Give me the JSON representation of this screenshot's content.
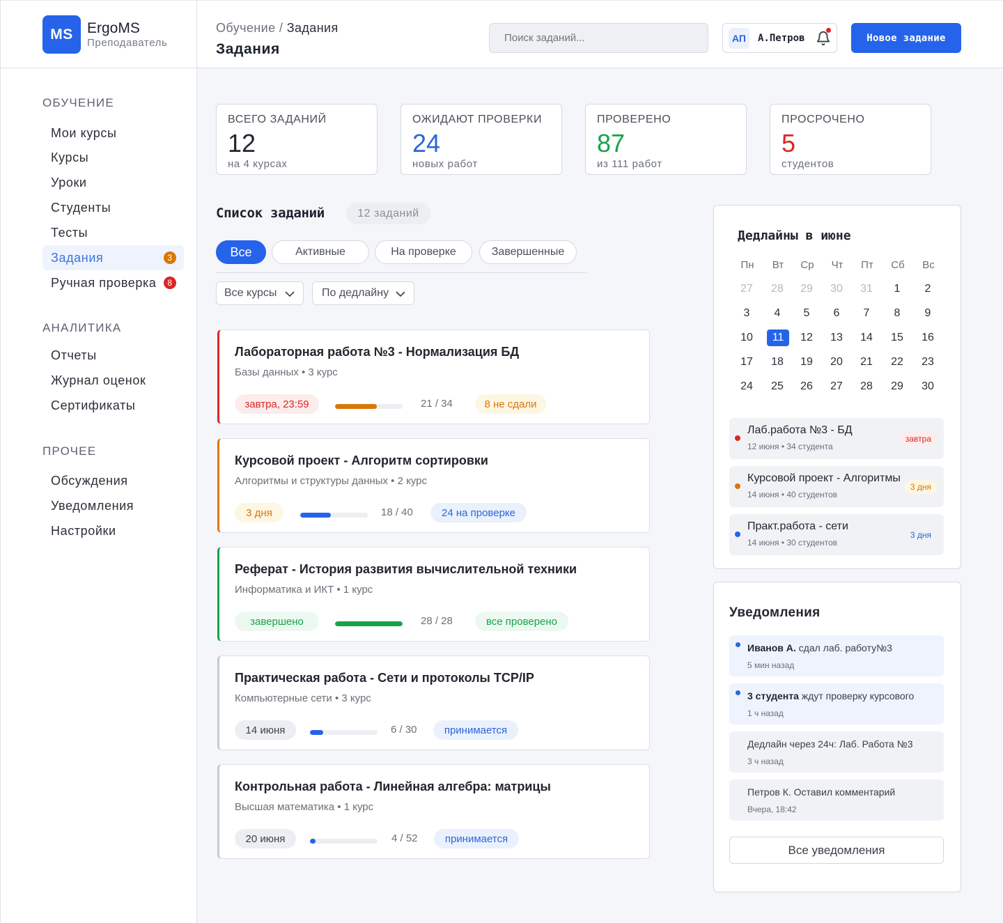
{
  "brand": {
    "logo_text": "MS",
    "name": "ErgoMS",
    "role": "Преподаватель"
  },
  "sidebar": {
    "sections": [
      {
        "title": "ОБУЧЕНИЕ",
        "items": [
          {
            "label": "Мои курсы"
          },
          {
            "label": "Курсы"
          },
          {
            "label": "Уроки"
          },
          {
            "label": "Студенты"
          },
          {
            "label": "Тесты"
          },
          {
            "label": "Задания",
            "badge": "3",
            "active": true
          },
          {
            "label": "Ручная проверка",
            "badge": "8"
          }
        ]
      },
      {
        "title": "АНАЛИТИКА",
        "items": [
          {
            "label": "Отчеты"
          },
          {
            "label": "Журнал оценок"
          },
          {
            "label": "Сертификаты"
          }
        ]
      },
      {
        "title": "ПРОЧЕЕ",
        "items": [
          {
            "label": "Обсуждения"
          },
          {
            "label": "Уведомления"
          },
          {
            "label": "Настройки"
          }
        ]
      }
    ]
  },
  "header": {
    "breadcrumb_parent": "Обучение",
    "breadcrumb_sep": " / ",
    "breadcrumb_current": "Задания",
    "title": "Задания",
    "search_placeholder": "Поиск заданий...",
    "user_initials": "АП",
    "user_name": "А.Петров",
    "new_button": "Новое задание"
  },
  "stats": [
    {
      "label": "ВСЕГО ЗАДАНИЙ",
      "value": "12",
      "sub": "на 4 курсах",
      "color": "#23262f"
    },
    {
      "label": "ОЖИДАЮТ ПРОВЕРКИ",
      "value": "24",
      "sub": "новых работ",
      "color": "#2d65d8"
    },
    {
      "label": "ПРОВЕРЕНО",
      "value": "87",
      "sub": "из 111 работ",
      "color": "#16a34a"
    },
    {
      "label": "ПРОСРОЧЕНО",
      "value": "5",
      "sub": "студентов",
      "color": "#dc2626"
    }
  ],
  "list": {
    "title": "Список заданий",
    "count": "12 заданий",
    "tabs": [
      "Все",
      "Активные",
      "На проверке",
      "Завершенные"
    ],
    "active_tab": 0,
    "filters": [
      "Все курсы",
      "По дедлайну"
    ]
  },
  "assignments": [
    {
      "title": "Лабораторная работа №3 - Нормализация БД",
      "subtitle": "Базы данных • 3 курс",
      "deadline": "завтра, 23:59",
      "progress": 0.62,
      "count": "21 / 34",
      "status": "8 не сдали",
      "accent": "#dc2626",
      "deadline_bg": "#fdecec",
      "deadline_color": "#dc2626",
      "bar_color": "#d97706",
      "status_bg": "#fdf6e3",
      "status_color": "#d97706"
    },
    {
      "title": "Курсовой проект - Алгоритм сортировки",
      "subtitle": "Алгоритмы и структуры данных • 2 курс",
      "deadline": "3 дня",
      "progress": 0.45,
      "count": "18 / 40",
      "status": "24 на проверке",
      "accent": "#d97706",
      "deadline_bg": "#fdf6e3",
      "deadline_color": "#d97706",
      "bar_color": "#2563eb",
      "status_bg": "#eaf1fd",
      "status_color": "#2d65d8"
    },
    {
      "title": "Реферат - История развития вычислительной техники",
      "subtitle": "Информатика и ИКТ • 1 курс",
      "deadline": "завершено",
      "progress": 1.0,
      "count": "28 / 28",
      "status": "все проверено",
      "accent": "#16a34a",
      "deadline_bg": "#ecf9f0",
      "deadline_color": "#16a34a",
      "bar_color": "#16a34a",
      "status_bg": "#ecf9f0",
      "status_color": "#16a34a"
    },
    {
      "title": "Практическая работа - Сети и протоколы TCP/IP",
      "subtitle": "Компьютерные сети • 3 курс",
      "deadline": "14 июня",
      "progress": 0.2,
      "count": "6 / 30",
      "status": "принимается",
      "accent": "#c6cad1",
      "deadline_bg": "#eceef2",
      "deadline_color": "#3b3f48",
      "bar_color": "#2563eb",
      "status_bg": "#eaf1fd",
      "status_color": "#2d65d8"
    },
    {
      "title": "Контрольная работа - Линейная алгебра: матрицы",
      "subtitle": "Высшая математика • 1 курс",
      "deadline": "20 июня",
      "progress": 0.08,
      "count": "4 / 52",
      "status": "принимается",
      "accent": "#c6cad1",
      "deadline_bg": "#eceef2",
      "deadline_color": "#3b3f48",
      "bar_color": "#2563eb",
      "status_bg": "#eaf1fd",
      "status_color": "#2d65d8"
    }
  ],
  "calendar": {
    "title": "Дедлайны в июне",
    "weekdays": [
      "Пн",
      "Вт",
      "Ср",
      "Чт",
      "Пт",
      "Сб",
      "Вс"
    ],
    "weeks": [
      [
        "27",
        "28",
        "29",
        "30",
        "31",
        "1",
        "2"
      ],
      [
        "3",
        "4",
        "5",
        "6",
        "7",
        "8",
        "9"
      ],
      [
        "10",
        "11",
        "12",
        "13",
        "14",
        "15",
        "16"
      ],
      [
        "17",
        "18",
        "19",
        "20",
        "21",
        "22",
        "23"
      ],
      [
        "24",
        "25",
        "26",
        "27",
        "28",
        "29",
        "30"
      ]
    ],
    "muted_days": [
      "27",
      "28",
      "29",
      "30",
      "31"
    ],
    "today": "11",
    "deadline_days": [
      "12",
      "13",
      "18",
      "19"
    ]
  },
  "deadlines": [
    {
      "title": "Лаб.работа №3 - БД",
      "sub": "12 июня • 34 студента",
      "tag": "завтра",
      "dot": "#dc2626",
      "tag_bg": "#fdecec",
      "tag_color": "#dc2626"
    },
    {
      "title": "Курсовой проект - Алгоритмы",
      "sub": "14 июня • 40 студентов",
      "tag": "3 дня",
      "dot": "#d97706",
      "tag_bg": "#fdf6e3",
      "tag_color": "#d97706"
    },
    {
      "title": "Практ.работа - сети",
      "sub": "14 июня • 30 студентов",
      "tag": "3 дня",
      "dot": "#2563eb",
      "tag_bg": "#f0f2f6",
      "tag_color": "#2d65d8"
    }
  ],
  "notifications": {
    "title": "Уведомления",
    "items": [
      {
        "bold": "Иванов А.",
        "text": " сдал лаб. работу№3",
        "time": "5 мин назад",
        "unread": true
      },
      {
        "bold": "3 студента",
        "text": " ждут проверку курсового",
        "time": "1 ч назад",
        "unread": true
      },
      {
        "bold": "",
        "text": "Дедлайн через 24ч: Лаб. Работа №3",
        "time": "3 ч назад",
        "unread": false
      },
      {
        "bold": "",
        "text": "Петров К. Оставил комментарий",
        "time": "Вчера, 18:42",
        "unread": false
      }
    ],
    "all_button": "Все уведомления"
  }
}
